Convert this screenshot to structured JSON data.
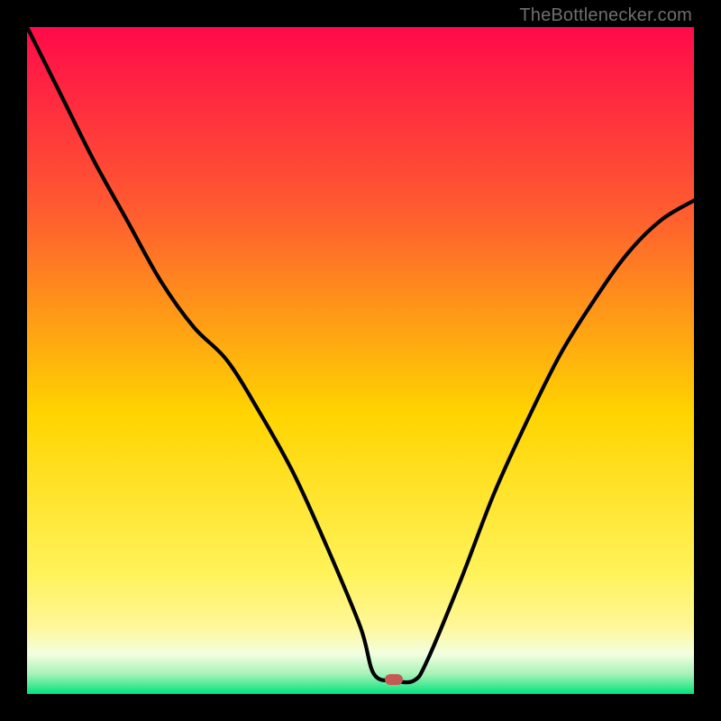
{
  "attribution": "TheBottlenecker.com",
  "colors": {
    "top": "#ff0a4a",
    "mid_upper": "#ff5d2f",
    "mid": "#ffd400",
    "mid_lower": "#fff79a",
    "band_pale": "#f2ffe0",
    "bottom": "#00e37a",
    "curve": "#000000",
    "marker": "#c35a54",
    "frame": "#000000",
    "attribution_text": "#6f6f6f"
  },
  "marker": {
    "x_pct": 55.0,
    "y_pct": 97.8
  },
  "chart_data": {
    "type": "line",
    "title": "",
    "xlabel": "",
    "ylabel": "",
    "xlim": [
      0,
      100
    ],
    "ylim": [
      0,
      100
    ],
    "grid": false,
    "legend": false,
    "series": [
      {
        "name": "bottleneck-curve",
        "x": [
          0,
          5,
          10,
          15,
          20,
          25,
          30,
          35,
          40,
          45,
          50,
          52,
          55,
          58,
          60,
          65,
          70,
          75,
          80,
          85,
          90,
          95,
          100
        ],
        "values": [
          100,
          90,
          80,
          71,
          62,
          55,
          50,
          42,
          33,
          22,
          10,
          3,
          2,
          2,
          5,
          17,
          30,
          41,
          51,
          59,
          66,
          71,
          74
        ]
      }
    ],
    "annotations": [
      {
        "type": "marker",
        "x": 55,
        "y": 2,
        "label": "optimal-point"
      }
    ]
  }
}
